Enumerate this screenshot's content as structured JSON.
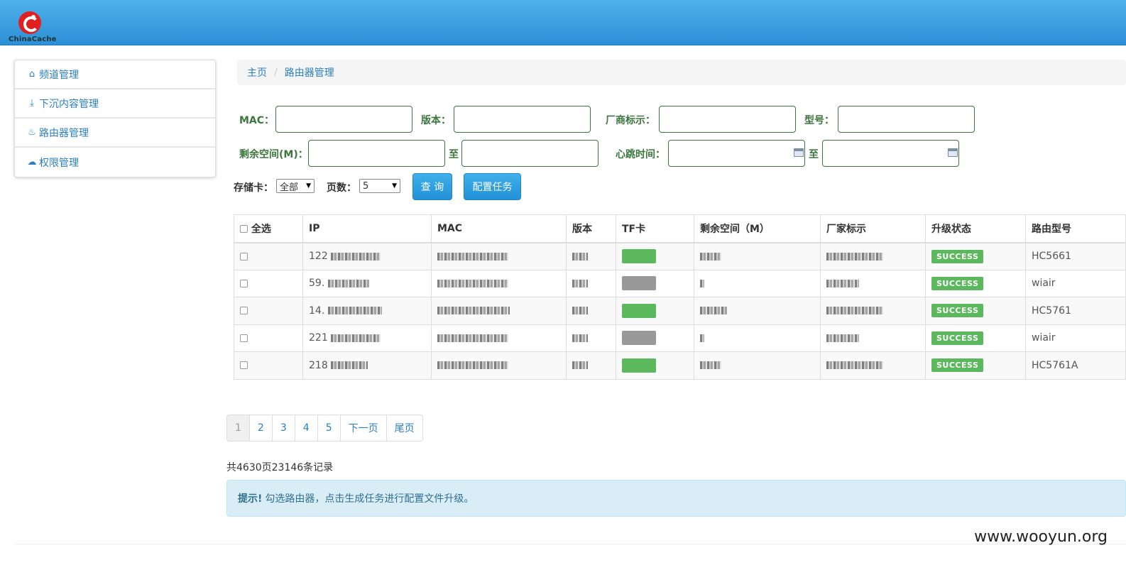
{
  "header": {
    "logo_text": "ChinaCache"
  },
  "sidebar": {
    "items": [
      {
        "icon": "home-icon",
        "label": "频道管理"
      },
      {
        "icon": "download-icon",
        "label": "下沉内容管理"
      },
      {
        "icon": "fire-icon",
        "label": "路由器管理"
      },
      {
        "icon": "cloud-icon",
        "label": "权限管理"
      }
    ]
  },
  "breadcrumb": {
    "home": "主页",
    "separator": "/",
    "current": "路由器管理"
  },
  "filters": {
    "mac_label": "MAC：",
    "version_label": "版本：",
    "vendor_label": "厂商标示：",
    "model_label": "型号：",
    "space_label": "剩余空间(M)：",
    "to_label": "至",
    "heartbeat_label": "心跳时间：",
    "storage_label": "存储卡：",
    "storage_value": "全部",
    "pages_label": "页数：",
    "pages_value": "5",
    "query_button": "查 询",
    "config_button": "配置任务"
  },
  "table": {
    "select_all": "全选",
    "columns": [
      "IP",
      "MAC",
      "版本",
      "TF卡",
      "剩余空间（M）",
      "厂家标示",
      "升级状态",
      "路由型号"
    ],
    "rows": [
      {
        "ip": "122",
        "status": "SUCCESS",
        "model": "HC5661",
        "tf": "green"
      },
      {
        "ip": "59.",
        "status": "SUCCESS",
        "model": "wiair",
        "tf": "gray"
      },
      {
        "ip": "14.",
        "status": "SUCCESS",
        "model": "HC5761",
        "tf": "green"
      },
      {
        "ip": "221",
        "status": "SUCCESS",
        "model": "wiair",
        "tf": "gray"
      },
      {
        "ip": "218",
        "status": "SUCCESS",
        "model": "HC5761A",
        "tf": "green"
      }
    ]
  },
  "pagination": {
    "pages": [
      "1",
      "2",
      "3",
      "4",
      "5"
    ],
    "next": "下一页",
    "last": "尾页",
    "current": "1"
  },
  "records_text": "共4630页23146条记录",
  "alert": {
    "title": "提示!",
    "text": "勾选路由器，点击生成任务进行配置文件升级。"
  },
  "watermark": "www.wooyun.org"
}
